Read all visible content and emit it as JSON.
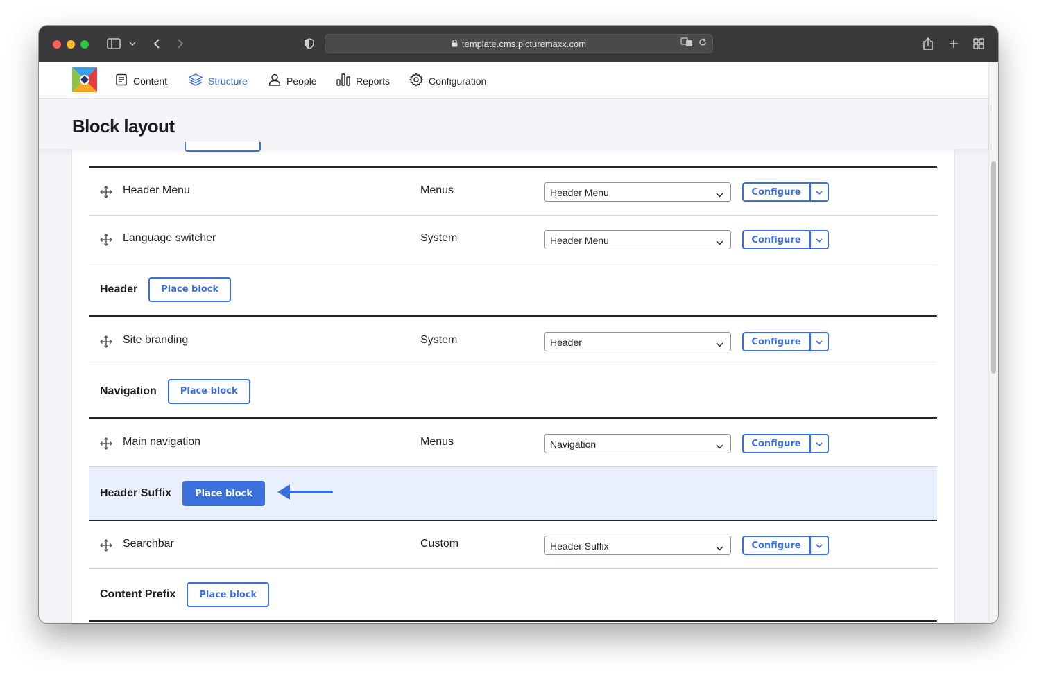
{
  "browser": {
    "url": "template.cms.picturemaxx.com"
  },
  "admin_nav": {
    "items": [
      {
        "label": "Content",
        "icon": "document-icon"
      },
      {
        "label": "Structure",
        "icon": "layers-icon",
        "active": true
      },
      {
        "label": "People",
        "icon": "person-icon"
      },
      {
        "label": "Reports",
        "icon": "bar-chart-icon"
      },
      {
        "label": "Configuration",
        "icon": "gear-icon"
      }
    ]
  },
  "page": {
    "title": "Block layout"
  },
  "labels": {
    "configure": "Configure",
    "place_block": "Place block"
  },
  "blocks": [
    {
      "name": "Header Menu",
      "category": "Menus",
      "region": "Header Menu"
    },
    {
      "name": "Language switcher",
      "category": "System",
      "region": "Header Menu"
    },
    {
      "name": "Site branding",
      "category": "System",
      "region": "Header"
    },
    {
      "name": "Main navigation",
      "category": "Menus",
      "region": "Navigation"
    },
    {
      "name": "Searchbar",
      "category": "Custom",
      "region": "Header Suffix"
    }
  ],
  "regions": [
    {
      "name": "Header"
    },
    {
      "name": "Navigation"
    },
    {
      "name": "Header Suffix",
      "highlighted": true
    },
    {
      "name": "Content Prefix"
    }
  ],
  "colors": {
    "accent": "#3b6fdc",
    "highlight_row": "#e9effc",
    "toolbar": "#3a3a3c"
  }
}
